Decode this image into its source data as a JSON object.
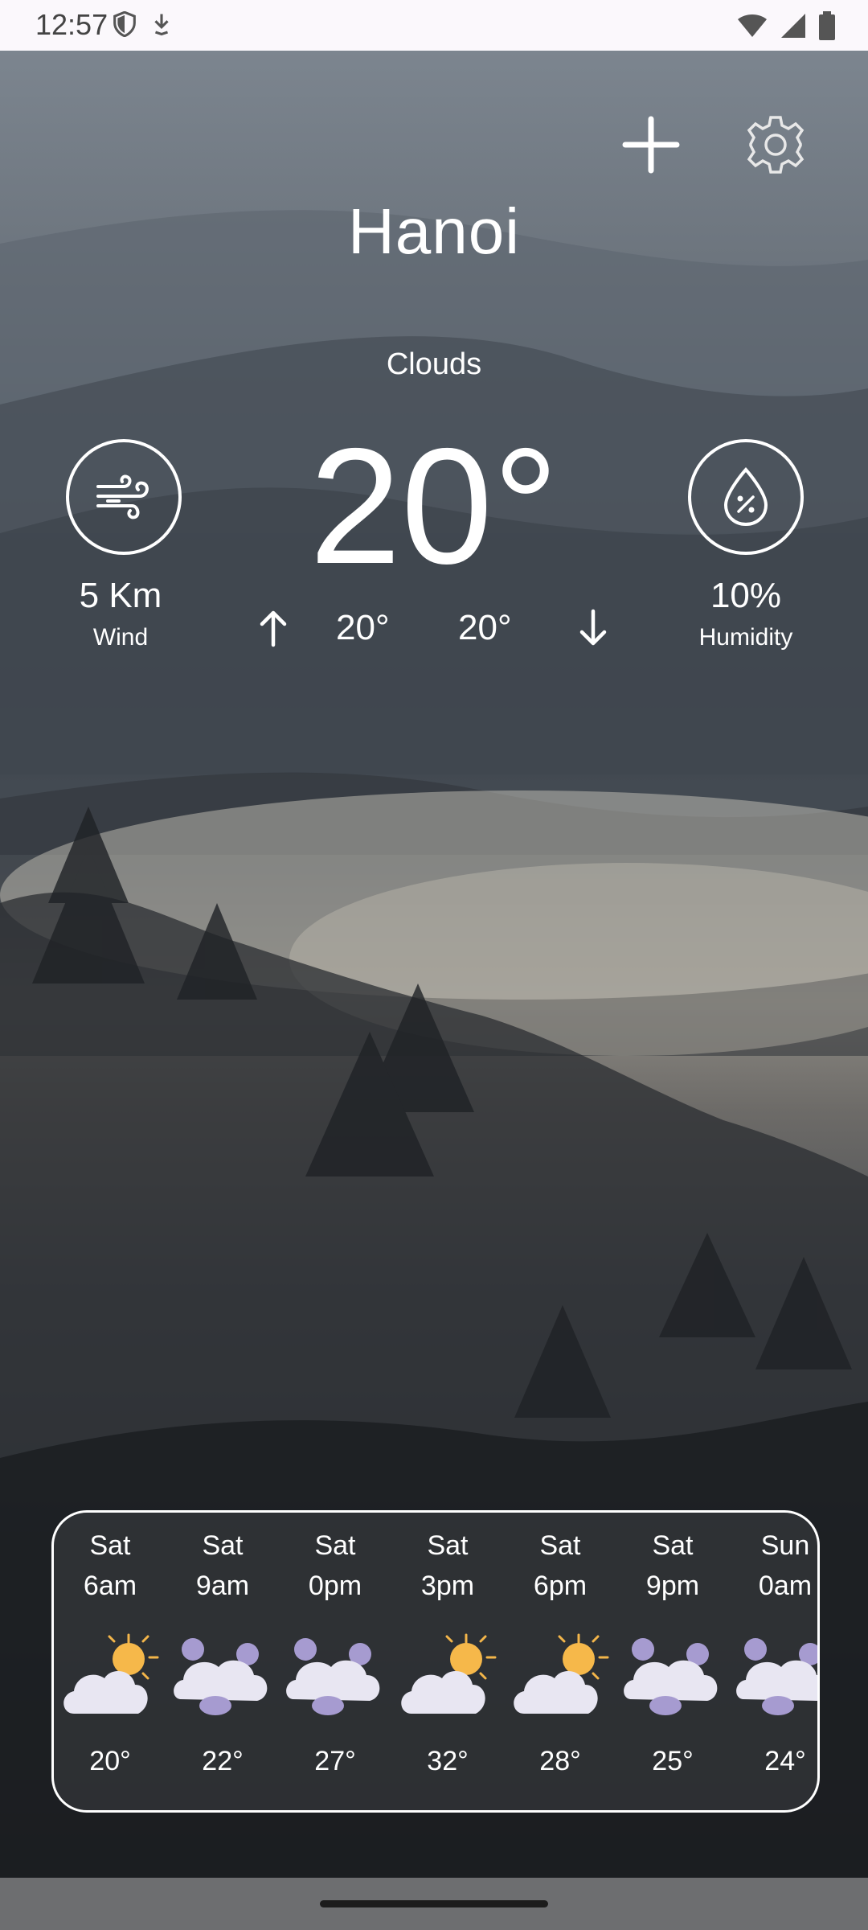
{
  "status": {
    "time": "12:57",
    "icons": [
      "shield-icon",
      "download-icon",
      "wifi-icon",
      "signal-icon",
      "battery-icon"
    ]
  },
  "header": {
    "add_icon": "plus-icon",
    "settings_icon": "gear-icon"
  },
  "weather": {
    "city": "Hanoi",
    "condition": "Clouds",
    "temperature": "20°",
    "high": "20°",
    "low": "20°",
    "wind": {
      "value": "5 Km",
      "label": "Wind",
      "icon": "wind-icon"
    },
    "humidity": {
      "value": "10%",
      "label": "Humidity",
      "icon": "humidity-drop-icon"
    }
  },
  "forecast": [
    {
      "day": "Sat",
      "time": "6am",
      "temp": "20°",
      "icon": "partly-sunny-icon"
    },
    {
      "day": "Sat",
      "time": "9am",
      "temp": "22°",
      "icon": "cloudy-icon"
    },
    {
      "day": "Sat",
      "time": "0pm",
      "temp": "27°",
      "icon": "cloudy-icon"
    },
    {
      "day": "Sat",
      "time": "3pm",
      "temp": "32°",
      "icon": "partly-sunny-icon"
    },
    {
      "day": "Sat",
      "time": "6pm",
      "temp": "28°",
      "icon": "partly-sunny-icon"
    },
    {
      "day": "Sat",
      "time": "9pm",
      "temp": "25°",
      "icon": "cloudy-icon"
    },
    {
      "day": "Sun",
      "time": "0am",
      "temp": "24°",
      "icon": "cloudy-icon"
    }
  ],
  "colors": {
    "status_bar_bg": "#fbf8fc",
    "text": "#ffffff",
    "nav_bar_bg": "#6d6e70"
  }
}
